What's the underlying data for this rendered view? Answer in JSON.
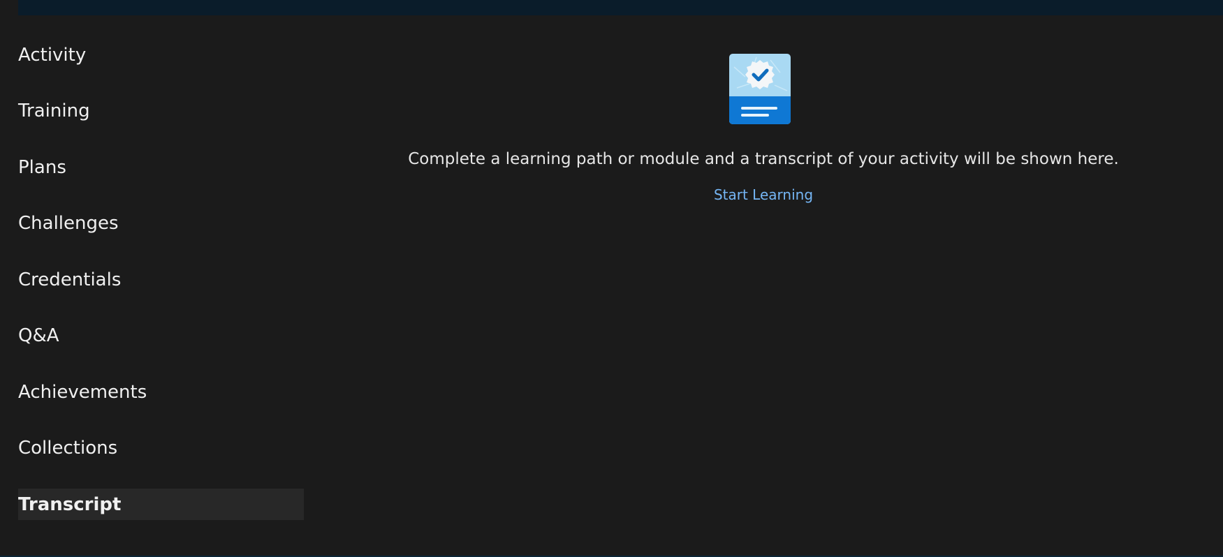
{
  "sidebar": {
    "items": [
      {
        "label": "Activity"
      },
      {
        "label": "Training"
      },
      {
        "label": "Plans"
      },
      {
        "label": "Challenges"
      },
      {
        "label": "Credentials"
      },
      {
        "label": "Q&A"
      },
      {
        "label": "Achievements"
      },
      {
        "label": "Collections"
      },
      {
        "label": "Transcript",
        "active": true
      }
    ]
  },
  "main": {
    "illustration_icon": "certificate-badge-icon",
    "message": "Complete a learning path or module and a transcript of your activity will be shown here.",
    "start_link_label": "Start Learning"
  },
  "colors": {
    "background": "#1b1b1b",
    "banner": "#0a1c2a",
    "active_item_bg": "#282828",
    "link": "#75b6f5",
    "badge_light": "#a9d9f3",
    "badge_dark": "#0f78d4"
  }
}
